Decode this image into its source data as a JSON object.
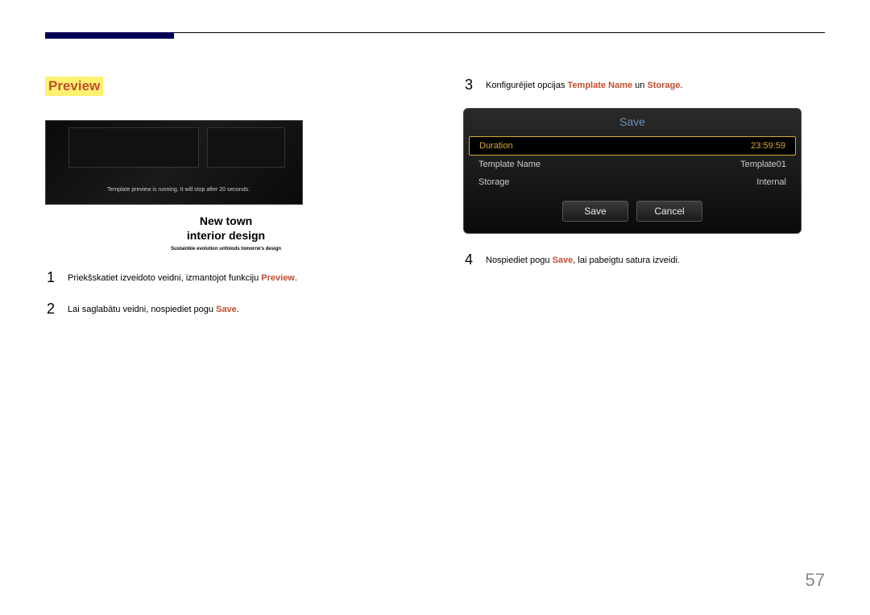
{
  "section_title": "Preview",
  "preview_running_text": "Template preview is running. It will stop after 20 seconds.",
  "new_town": {
    "line1": "New town",
    "line2": "interior design",
    "tagline": "Sustainble evolution unfolods tomorrw's design"
  },
  "steps": {
    "s1": {
      "num": "1",
      "pre": "Priekšskatiet izveidoto veidni, izmantojot funkciju ",
      "hl": "Preview",
      "post": "."
    },
    "s2": {
      "num": "2",
      "pre": "Lai saglabātu veidni, nospiediet pogu ",
      "hl": "Save",
      "post": "."
    },
    "s3": {
      "num": "3",
      "pre": "Konfigurējiet opcijas ",
      "hl1": "Template Name",
      "mid": " un ",
      "hl2": "Storage",
      "post": "."
    },
    "s4": {
      "num": "4",
      "pre": "Nospiediet pogu ",
      "hl": "Save",
      "post": ", lai pabeigtu satura izveidi."
    }
  },
  "dialog": {
    "title": "Save",
    "rows": {
      "duration": {
        "label": "Duration",
        "value": "23:59:59"
      },
      "tname": {
        "label": "Template Name",
        "value": "Template01"
      },
      "storage": {
        "label": "Storage",
        "value": "Internal"
      }
    },
    "save_btn": "Save",
    "cancel_btn": "Cancel"
  },
  "page_number": "57"
}
